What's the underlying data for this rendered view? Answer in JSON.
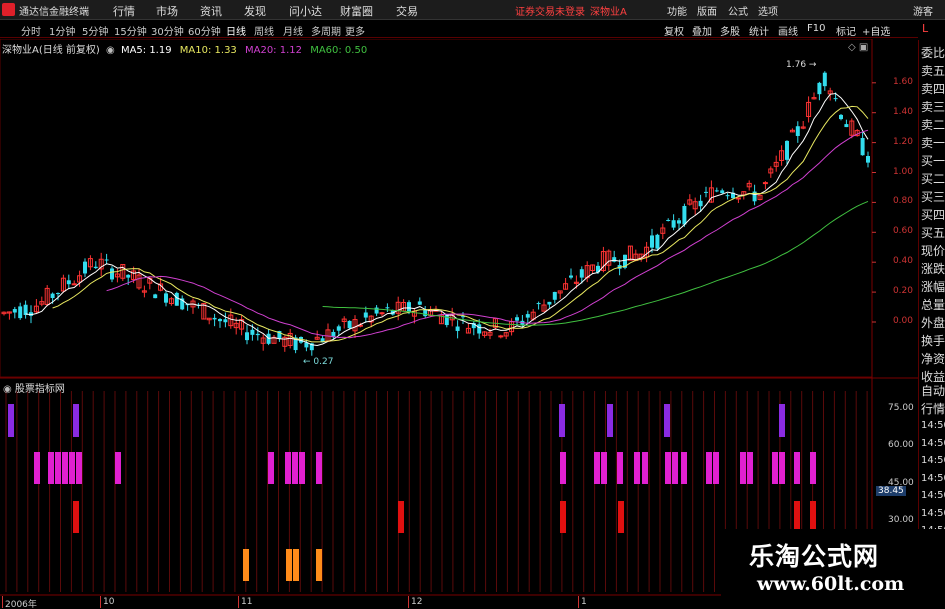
{
  "titlebar": {
    "app_name": "通达信金融终端",
    "menus": [
      "行情",
      "市场",
      "资讯",
      "发现",
      "问小达",
      "财富圈",
      "交易"
    ],
    "notice": "证券交易未登录",
    "stock_title": "深物业A",
    "right_menus": [
      "功能",
      "版面",
      "公式",
      "选项"
    ],
    "guest": "游客"
  },
  "tabbar": {
    "periods": [
      "分时",
      "1分钟",
      "5分钟",
      "15分钟",
      "30分钟",
      "60分钟",
      "日线",
      "周线",
      "月线",
      "多周期",
      "更多"
    ],
    "right_tools": [
      "复权",
      "叠加",
      "多股",
      "统计",
      "画线",
      "F10",
      "标记",
      "+自选",
      "L"
    ]
  },
  "ma_legend": {
    "stock": "深物业A(日线 前复权)",
    "ma5": "MA5: 1.19",
    "ma10": "MA10: 1.33",
    "ma20": "MA20: 1.12",
    "ma60": "MA60: 0.50"
  },
  "colors": {
    "ma5": "#ffffff",
    "ma10": "#e8e860",
    "ma20": "#d040d0",
    "ma60": "#40c040",
    "up": "#ff3333",
    "down": "#33ddee",
    "purple_signal": "#8a2be2",
    "magenta_signal": "#e020d0",
    "red_signal": "#e01010",
    "orange_signal": "#ff8c1a"
  },
  "price_axis": [
    "1.60",
    "1.40",
    "1.20",
    "1.00",
    "0.80",
    "0.60",
    "0.40",
    "0.20",
    "0.00"
  ],
  "annotations": {
    "high": "1.76",
    "low": "0.27"
  },
  "indicator_panel": {
    "title": "股票指标网",
    "axis": [
      "75.00",
      "60.00",
      "45.00",
      "30.00"
    ],
    "current_value": "38.45"
  },
  "date_axis": [
    "2006年",
    "10",
    "11",
    "12",
    "1"
  ],
  "sidebar": {
    "items": [
      "委比",
      "卖五",
      "卖四",
      "卖三",
      "卖二",
      "卖一",
      "买一",
      "买二",
      "买三",
      "买四",
      "买五",
      "现价",
      "涨跌",
      "涨幅",
      "总量",
      "外盘",
      "换手",
      "净资",
      "收益",
      "自动",
      "行情",
      "14:50",
      "14:50",
      "14:50",
      "14:50",
      "14:50",
      "14:50",
      "14:50"
    ]
  },
  "watermark": {
    "title": "乐淘公式网",
    "url": "www.60lt.com"
  }
}
